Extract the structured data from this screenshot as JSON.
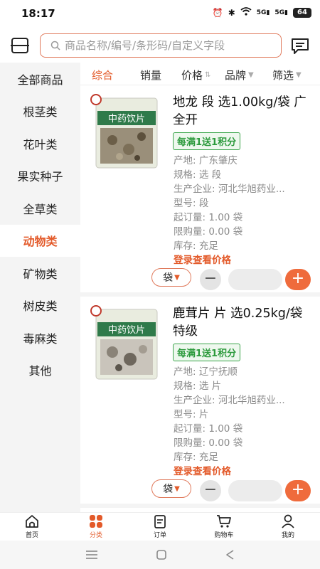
{
  "status": {
    "time": "18:17",
    "battery": "64",
    "signal1": "5G",
    "signal2": "5G"
  },
  "search": {
    "placeholder": "商品名称/编号/条形码/自定义字段"
  },
  "sidebar": {
    "items": [
      {
        "label": "全部商品"
      },
      {
        "label": "根茎类"
      },
      {
        "label": "花叶类"
      },
      {
        "label": "果实种子"
      },
      {
        "label": "全草类"
      },
      {
        "label": "动物类"
      },
      {
        "label": "矿物类"
      },
      {
        "label": "树皮类"
      },
      {
        "label": "毒麻类"
      },
      {
        "label": "其他"
      }
    ],
    "active_index": 5
  },
  "sortbar": {
    "comprehensive": "综合",
    "sales": "销量",
    "price": "价格",
    "brand": "品牌",
    "filter": "筛选"
  },
  "products": [
    {
      "name": "地龙 段 选1.00kg/袋 广全开",
      "promo": "每满1送1积分",
      "origin": "产地: 广东肇庆",
      "spec": "规格: 选 段",
      "maker": "生产企业: 河北华旭药业...",
      "model": "型号: 段",
      "min_order": "起订量: 1.00 袋",
      "limit": "限购量: 0.00 袋",
      "stock": "库存: 充足",
      "login_price": "登录查看价格",
      "unit": "袋",
      "package_label": "中药饮片"
    },
    {
      "name": "鹿茸片 片 选0.25kg/袋 特级",
      "promo": "每满1送1积分",
      "origin": "产地: 辽宁抚顺",
      "spec": "规格: 选 片",
      "maker": "生产企业: 河北华旭药业...",
      "model": "型号: 片",
      "min_order": "起订量: 1.00 袋",
      "limit": "限购量: 0.00 袋",
      "stock": "库存: 充足",
      "login_price": "登录查看价格",
      "unit": "袋",
      "package_label": "中药饮片"
    }
  ],
  "tabbar": {
    "home": "首页",
    "category": "分类",
    "orders": "订单",
    "cart": "购物车",
    "mine": "我的"
  },
  "colors": {
    "accent": "#e35a2a",
    "promo_green": "#2c9a3c"
  }
}
